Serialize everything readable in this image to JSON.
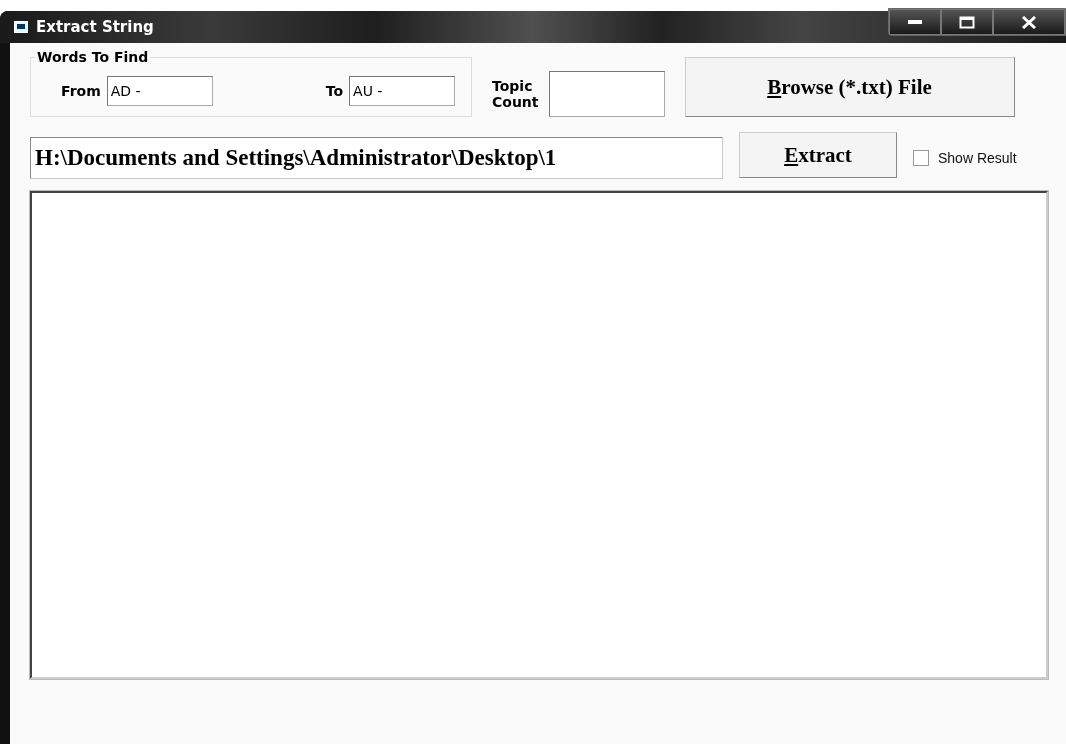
{
  "window": {
    "title": "Extract String"
  },
  "words_group": {
    "title": "Words To Find",
    "from_label": "From",
    "from_value": "AD -",
    "to_label": "To",
    "to_value": "AU -"
  },
  "topic_count": {
    "label_lines": [
      "Topic",
      "Count"
    ]
  },
  "browse_button": {
    "label": "Browse (*.txt) File",
    "mnemonic_first_letter": true
  },
  "path_field": {
    "value": "H:\\Documents and Settings\\Administrator\\Desktop\\1"
  },
  "extract_button": {
    "label": "Extract",
    "mnemonic_first_letter": true
  },
  "show_result": {
    "label": "Show Result",
    "checked": false
  }
}
